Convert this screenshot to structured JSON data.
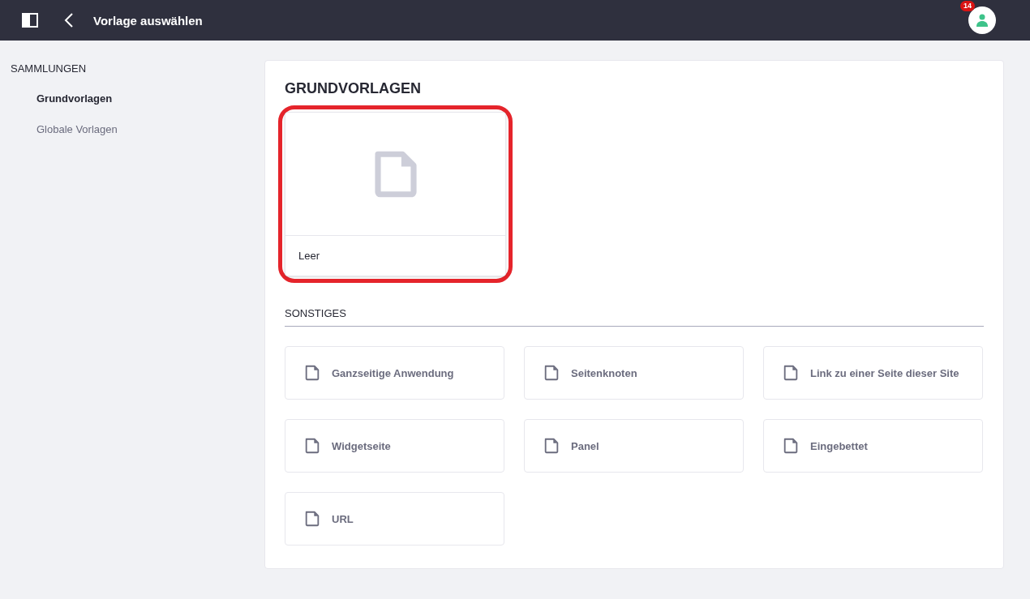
{
  "header": {
    "title": "Vorlage auswählen",
    "notification_count": "14"
  },
  "sidebar": {
    "heading": "SAMMLUNGEN",
    "items": [
      {
        "label": "Grundvorlagen",
        "selected": true
      },
      {
        "label": "Globale Vorlagen",
        "selected": false
      }
    ]
  },
  "main": {
    "title": "GRUNDVORLAGEN",
    "cards": [
      {
        "label": "Leer",
        "highlighted": true
      }
    ],
    "section": {
      "heading": "SONSTIGES",
      "items": [
        {
          "label": "Ganzseitige Anwendung"
        },
        {
          "label": "Seitenknoten"
        },
        {
          "label": "Link zu einer Seite dieser Site"
        },
        {
          "label": "Widgetseite"
        },
        {
          "label": "Panel"
        },
        {
          "label": "Eingebettet"
        },
        {
          "label": "URL"
        }
      ]
    }
  }
}
